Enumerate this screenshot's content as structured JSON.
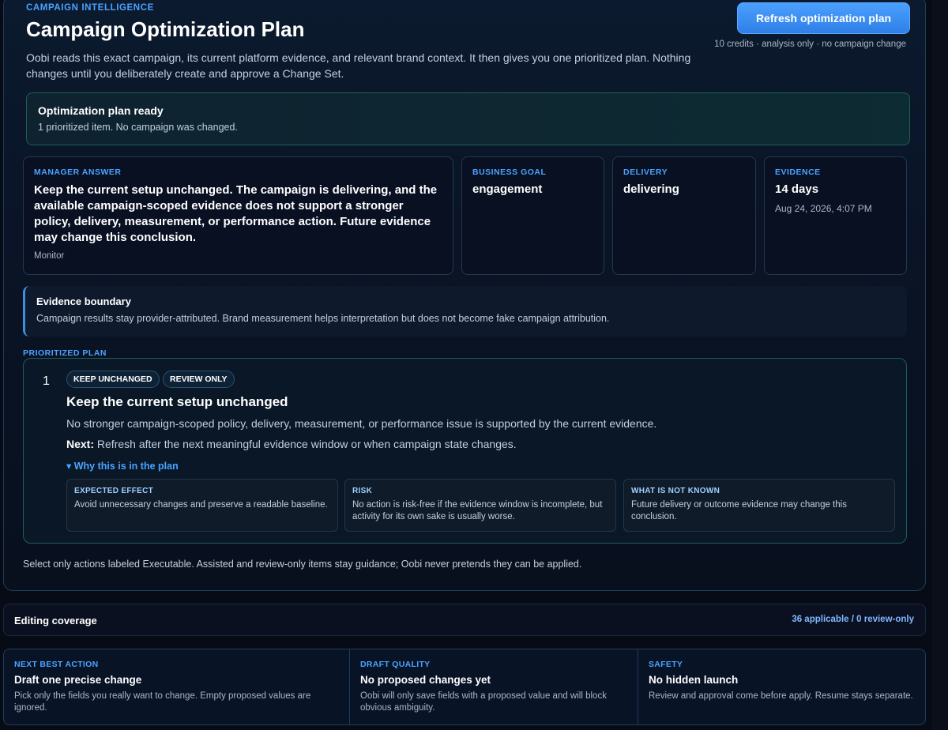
{
  "header": {
    "eyebrow": "CAMPAIGN INTELLIGENCE",
    "title": "Campaign Optimization Plan",
    "description": "Oobi reads this exact campaign, its current platform evidence, and relevant brand context. It then gives you one prioritized plan. Nothing changes until you deliberately create and approve a Change Set.",
    "refresh_label": "Refresh optimization plan",
    "credits_note": "10 credits · analysis only · no campaign change"
  },
  "status": {
    "title": "Optimization plan ready",
    "subtitle": "1 prioritized item. No campaign was changed."
  },
  "manager": {
    "label": "MANAGER ANSWER",
    "answer": "Keep the current setup unchanged. The campaign is delivering, and the available campaign-scoped evidence does not support a stronger policy, delivery, measurement, or performance action. Future evidence may change this conclusion.",
    "footer": "Monitor"
  },
  "stats": {
    "goal_label": "BUSINESS GOAL",
    "goal_value": "engagement",
    "delivery_label": "DELIVERY",
    "delivery_value": "delivering",
    "evidence_label": "EVIDENCE",
    "evidence_value": "14 days",
    "evidence_date": "Aug 24, 2026, 4:07 PM"
  },
  "boundary": {
    "title": "Evidence boundary",
    "text": "Campaign results stay provider-attributed. Brand measurement helps interpretation but does not become fake campaign attribution."
  },
  "plan": {
    "section_label": "PRIORITIZED PLAN",
    "number": "1",
    "tags": [
      "KEEP UNCHANGED",
      "REVIEW ONLY"
    ],
    "title": "Keep the current setup unchanged",
    "description": "No stronger campaign-scoped policy, delivery, measurement, or performance issue is supported by the current evidence.",
    "next_label": "Next:",
    "next_text": "Refresh after the next meaningful evidence window or when campaign state changes.",
    "why_label": "▾ Why this is in the plan",
    "details": [
      {
        "label": "EXPECTED EFFECT",
        "text": "Avoid unnecessary changes and preserve a readable baseline."
      },
      {
        "label": "RISK",
        "text": "No action is risk-free if the evidence window is incomplete, but activity for its own sake is usually worse."
      },
      {
        "label": "WHAT IS NOT KNOWN",
        "text": "Future delivery or outcome evidence may change this conclusion."
      }
    ],
    "footnote": "Select only actions labeled Executable. Assisted and review-only items stay guidance; Oobi never pretends they can be applied."
  },
  "coverage": {
    "title": "Editing coverage",
    "count": "36 applicable / 0 review-only"
  },
  "bottom": [
    {
      "label": "NEXT BEST ACTION",
      "title": "Draft one precise change",
      "text": "Pick only the fields you really want to change. Empty proposed values are ignored."
    },
    {
      "label": "DRAFT QUALITY",
      "title": "No proposed changes yet",
      "text": "Oobi will only save fields with a proposed value and will block obvious ambiguity."
    },
    {
      "label": "SAFETY",
      "title": "No hidden launch",
      "text": "Review and approval come before apply. Resume stays separate."
    }
  ]
}
